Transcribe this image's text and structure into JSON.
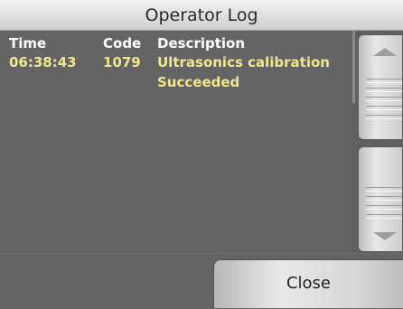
{
  "window": {
    "title": "Operator Log"
  },
  "log": {
    "columns": {
      "time": "Time",
      "code": "Code",
      "description": "Description"
    },
    "entries": [
      {
        "time": "06:38:43",
        "code": "1079",
        "description_line1": "Ultrasonics calibration",
        "description_line2": "Succeeded"
      }
    ]
  },
  "actions": {
    "close_label": "Close"
  },
  "colors": {
    "header_text": "#ffffff",
    "entry_text": "#f0e68c",
    "background": "#646464"
  },
  "icons": {
    "scroll_up": "triangle-up-icon",
    "scroll_down": "triangle-down-icon"
  }
}
